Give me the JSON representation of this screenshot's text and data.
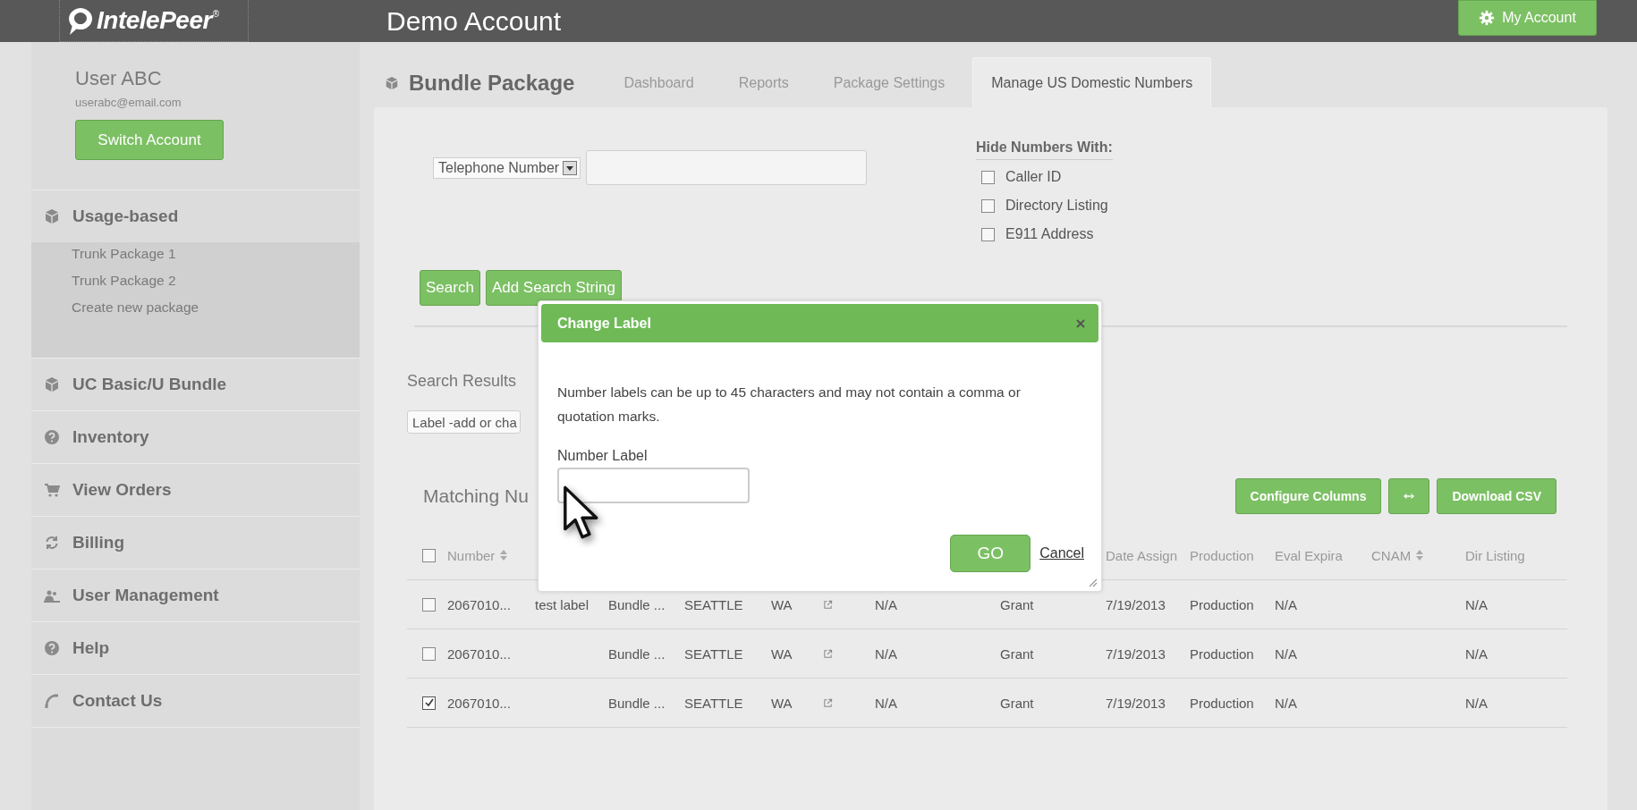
{
  "header": {
    "logo": "IntelePeer",
    "logo_mark": "®",
    "title": "Demo Account",
    "account_button": "My Account"
  },
  "sidebar": {
    "user_name": "User ABC",
    "user_email": "userabc@email.com",
    "switch_button": "Switch Account",
    "items": [
      {
        "label": "Usage-based",
        "expanded": true,
        "children": [
          {
            "label": "Trunk Package 1"
          },
          {
            "label": "Trunk Package 2"
          },
          {
            "label": "Create new package"
          }
        ]
      },
      {
        "label": "UC Basic/U Bundle",
        "expanded": false
      },
      {
        "label": "Inventory",
        "expanded": false
      },
      {
        "label": "View Orders",
        "expanded": false
      },
      {
        "label": "Billing",
        "expanded": false
      },
      {
        "label": "User Management",
        "expanded": false
      },
      {
        "label": "Help",
        "expanded": false
      },
      {
        "label": "Contact Us",
        "expanded": false
      }
    ]
  },
  "page_title": "Bundle Package",
  "tabs": [
    {
      "label": "Dashboard",
      "selected": false
    },
    {
      "label": "Reports",
      "selected": false
    },
    {
      "label": "Package Settings",
      "selected": false
    },
    {
      "label": "Manage US Domestic Numbers",
      "selected": true
    }
  ],
  "search": {
    "field_select": "Telephone Number",
    "hide_heading": "Hide Numbers With:",
    "hide_options": [
      {
        "label": "Caller ID",
        "checked": false
      },
      {
        "label": "Directory Listing",
        "checked": false
      },
      {
        "label": "E911 Address",
        "checked": false
      }
    ],
    "buttons": [
      "Search",
      "Add Search String"
    ]
  },
  "results": {
    "heading": "Search Results",
    "action_select": "Label -add or cha",
    "matching_heading": "Matching Nu",
    "buttons": [
      {
        "kind": "text",
        "label": "Configure Columns"
      },
      {
        "kind": "expand"
      },
      {
        "kind": "text",
        "label": "Download CSV"
      }
    ]
  },
  "table": {
    "all_checked": false,
    "columns": [
      {
        "label": "Number",
        "sortable": true
      },
      {
        "label": "Date Assign",
        "sortable": false
      },
      {
        "label": "Production",
        "sortable": false
      },
      {
        "label": "Eval Expira",
        "sortable": false
      },
      {
        "label": "CNAM",
        "sortable": true
      },
      {
        "label": "Dir Listing",
        "sortable": false
      }
    ],
    "rows": [
      {
        "checked": false,
        "number": "2067010...",
        "column_2": "test label",
        "column_3": "Bundle ...",
        "column_4": "SEATTLE",
        "column_5": "WA",
        "column_7": "N/A",
        "column_8": "Grant",
        "date_assigned": "7/19/2013",
        "production": "Production",
        "eval_expiration": "N/A",
        "dir_listing": "N/A"
      },
      {
        "checked": false,
        "number": "2067010...",
        "column_3": "Bundle ...",
        "column_4": "SEATTLE",
        "column_5": "WA",
        "column_7": "N/A",
        "column_8": "Grant",
        "date_assigned": "7/19/2013",
        "production": "Production",
        "eval_expiration": "N/A",
        "dir_listing": "N/A"
      },
      {
        "checked": true,
        "number": "2067010...",
        "column_3": "Bundle ...",
        "column_4": "SEATTLE",
        "column_5": "WA",
        "column_7": "N/A",
        "column_8": "Grant",
        "date_assigned": "7/19/2013",
        "production": "Production",
        "eval_expiration": "N/A",
        "dir_listing": "N/A"
      }
    ]
  },
  "dialog": {
    "title": "Change Label",
    "message": "Number labels can be up to 45 characters and may not contain a comma or quotation marks.",
    "field_label": "Number Label",
    "go_button": "GO",
    "cancel_link": "Cancel"
  }
}
